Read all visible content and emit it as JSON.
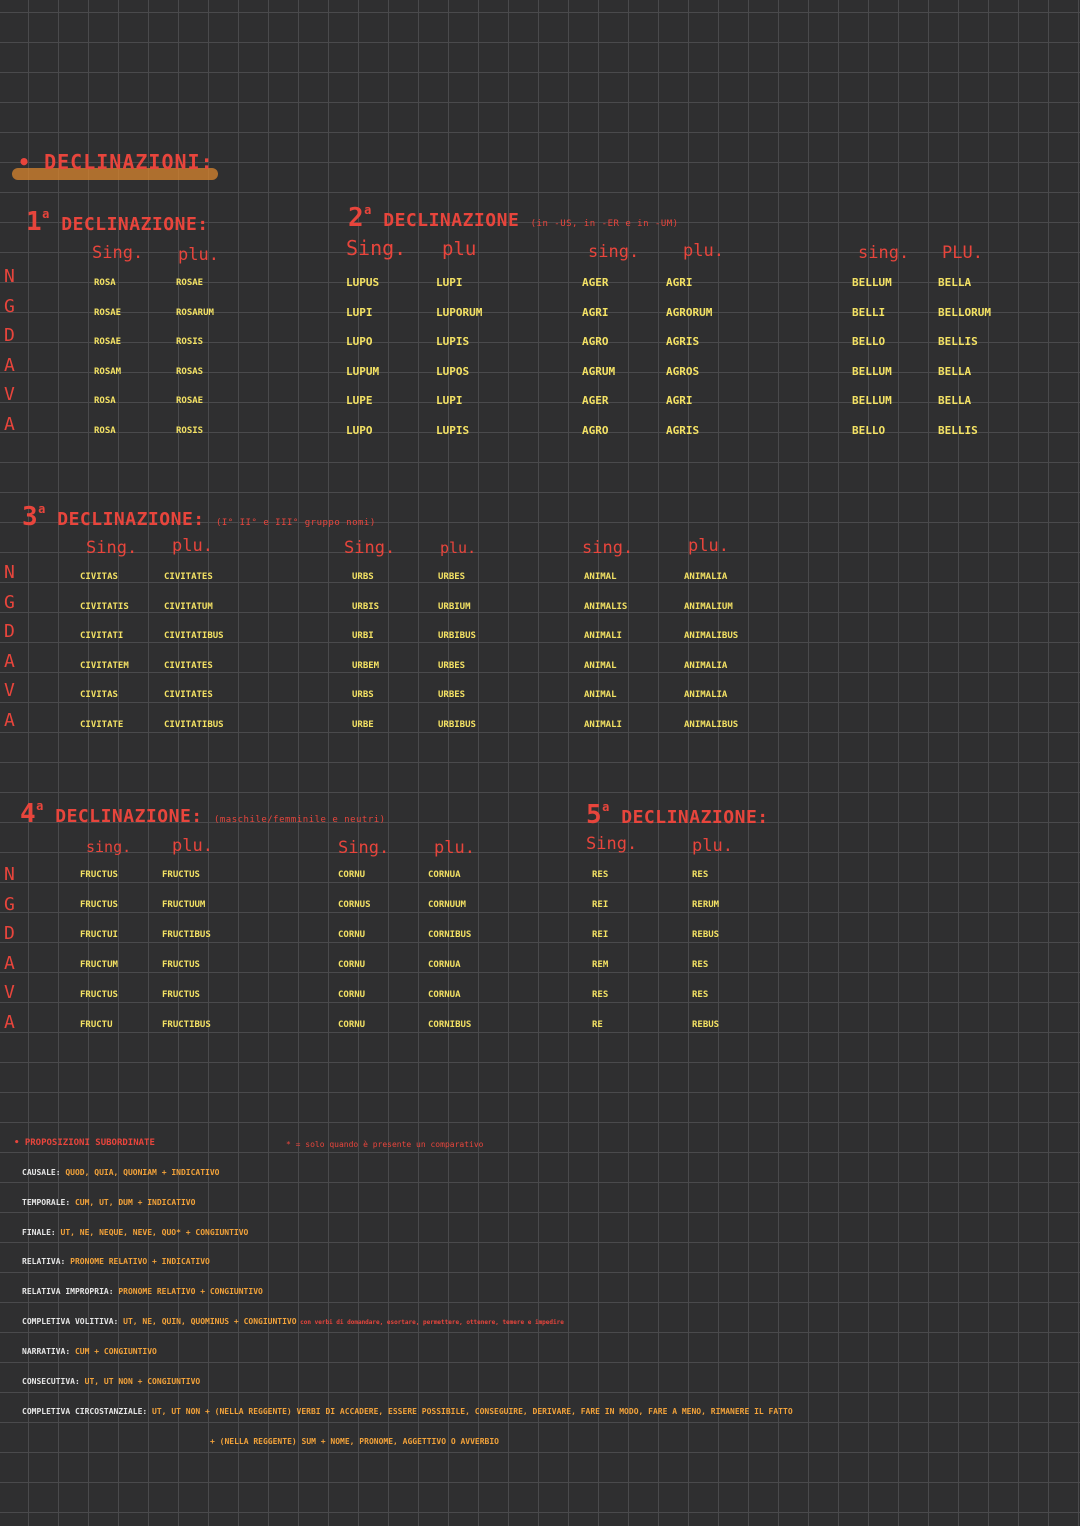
{
  "page_title": "DECLINAZIONI:",
  "case_letters": [
    "N",
    "G",
    "D",
    "A",
    "V",
    "A"
  ],
  "decl1": {
    "title_num": "1",
    "title_sup": "a",
    "title_text": "DECLINAZIONE:",
    "sing_label": "Sing.",
    "plu_label": "plu.",
    "sing": [
      "ROSA",
      "ROSAE",
      "ROSAE",
      "ROSAM",
      "ROSA",
      "ROSA"
    ],
    "plu": [
      "ROSAE",
      "ROSARUM",
      "ROSIS",
      "ROSAS",
      "ROSAE",
      "ROSIS"
    ]
  },
  "decl2": {
    "title_num": "2",
    "title_sup": "a",
    "title_text": "DECLINAZIONE",
    "title_note": "(in -US, in -ER e in -UM)",
    "t1": {
      "sing_label": "Sing.",
      "plu_label": "plu",
      "sing": [
        "LUPUS",
        "LUPI",
        "LUPO",
        "LUPUM",
        "LUPE",
        "LUPO"
      ],
      "plu": [
        "LUPI",
        "LUPORUM",
        "LUPIS",
        "LUPOS",
        "LUPI",
        "LUPIS"
      ]
    },
    "t2": {
      "sing_label": "sing.",
      "plu_label": "plu.",
      "sing": [
        "AGER",
        "AGRI",
        "AGRO",
        "AGRUM",
        "AGER",
        "AGRO"
      ],
      "plu": [
        "AGRI",
        "AGRORUM",
        "AGRIS",
        "AGROS",
        "AGRI",
        "AGRIS"
      ]
    },
    "t3": {
      "sing_label": "sing.",
      "plu_label": "PLU.",
      "sing": [
        "BELLUM",
        "BELLI",
        "BELLO",
        "BELLUM",
        "BELLUM",
        "BELLO"
      ],
      "plu": [
        "BELLA",
        "BELLORUM",
        "BELLIS",
        "BELLA",
        "BELLA",
        "BELLIS"
      ]
    }
  },
  "decl3": {
    "title_num": "3",
    "title_sup": "a",
    "title_text": "DECLINAZIONE:",
    "title_note": "(I° II° e III° gruppo nomi)",
    "t1": {
      "sing_label": "Sing.",
      "plu_label": "plu.",
      "sing": [
        "CIVITAS",
        "CIVITATIS",
        "CIVITATI",
        "CIVITATEM",
        "CIVITAS",
        "CIVITATE"
      ],
      "plu": [
        "CIVITATES",
        "CIVITATUM",
        "CIVITATIBUS",
        "CIVITATES",
        "CIVITATES",
        "CIVITATIBUS"
      ]
    },
    "t2": {
      "sing_label": "Sing.",
      "plu_label": "plu.",
      "sing": [
        "URBS",
        "URBIS",
        "URBI",
        "URBEM",
        "URBS",
        "URBE"
      ],
      "plu": [
        "URBES",
        "URBIUM",
        "URBIBUS",
        "URBES",
        "URBES",
        "URBIBUS"
      ]
    },
    "t3": {
      "sing_label": "sing.",
      "plu_label": "plu.",
      "sing": [
        "ANIMAL",
        "ANIMALIS",
        "ANIMALI",
        "ANIMAL",
        "ANIMAL",
        "ANIMALI"
      ],
      "plu": [
        "ANIMALIA",
        "ANIMALIUM",
        "ANIMALIBUS",
        "ANIMALIA",
        "ANIMALIA",
        "ANIMALIBUS"
      ]
    }
  },
  "decl4": {
    "title_num": "4",
    "title_sup": "a",
    "title_text": "DECLINAZIONE:",
    "title_note": "(maschile/femminile e neutri)",
    "t1": {
      "sing_label": "sing.",
      "plu_label": "plu.",
      "sing": [
        "FRUCTUS",
        "FRUCTUS",
        "FRUCTUI",
        "FRUCTUM",
        "FRUCTUS",
        "FRUCTU"
      ],
      "plu": [
        "FRUCTUS",
        "FRUCTUUM",
        "FRUCTIBUS",
        "FRUCTUS",
        "FRUCTUS",
        "FRUCTIBUS"
      ]
    },
    "t2": {
      "sing_label": "Sing.",
      "plu_label": "plu.",
      "sing": [
        "CORNU",
        "CORNUS",
        "CORNU",
        "CORNU",
        "CORNU",
        "CORNU"
      ],
      "plu": [
        "CORNUA",
        "CORNUUM",
        "CORNIBUS",
        "CORNUA",
        "CORNUA",
        "CORNIBUS"
      ]
    }
  },
  "decl5": {
    "title_num": "5",
    "title_sup": "a",
    "title_text": "DECLINAZIONE:",
    "t1": {
      "sing_label": "Sing.",
      "plu_label": "plu.",
      "sing": [
        "RES",
        "REI",
        "REI",
        "REM",
        "RES",
        "RE"
      ],
      "plu": [
        "RES",
        "RERUM",
        "REBUS",
        "RES",
        "RES",
        "REBUS"
      ]
    }
  },
  "clauses": {
    "title": "PROPOSIZIONI SUBORDINATE",
    "star_note": "* = solo quando è presente un comparativo",
    "lines": [
      {
        "label": "CAUSALE:",
        "text": "QUOD, QUIA, QUONIAM + INDICATIVO",
        "note": ""
      },
      {
        "label": "TEMPORALE:",
        "text": "CUM, UT, DUM + INDICATIVO",
        "note": ""
      },
      {
        "label": "FINALE:",
        "text": "UT, NE, NEQUE, NEVE, QUO* + CONGIUNTIVO",
        "note": ""
      },
      {
        "label": "RELATIVA:",
        "text": "PRONOME RELATIVO + INDICATIVO",
        "note": ""
      },
      {
        "label": "RELATIVA IMPROPRIA:",
        "text": "PRONOME RELATIVO + CONGIUNTIVO",
        "note": ""
      },
      {
        "label": "COMPLETIVA VOLITIVA:",
        "text": "UT, NE, QUIN, QUOMINUS + CONGIUNTIVO",
        "note": "con verbi di domandare, esortare, permettere, ottenere, temere e impedire"
      },
      {
        "label": "NARRATIVA:",
        "text": "CUM + CONGIUNTIVO",
        "note": ""
      },
      {
        "label": "CONSECUTIVA:",
        "text": "UT, UT NON + CONGIUNTIVO",
        "note": ""
      },
      {
        "label": "COMPLETIVA CIRCOSTANZIALE:",
        "text": "UT, UT NON + (NELLA REGGENTE) VERBI DI ACCADERE, ESSERE POSSIBILE, CONSEGUIRE, DERIVARE, FARE IN MODO, FARE A MENO, RIMANERE IL FATTO",
        "note": ""
      },
      {
        "label": "",
        "text": "+ (NELLA REGGENTE) SUM + NOME, PRONOME, AGGETTIVO O AVVERBIO",
        "note": ""
      }
    ]
  }
}
